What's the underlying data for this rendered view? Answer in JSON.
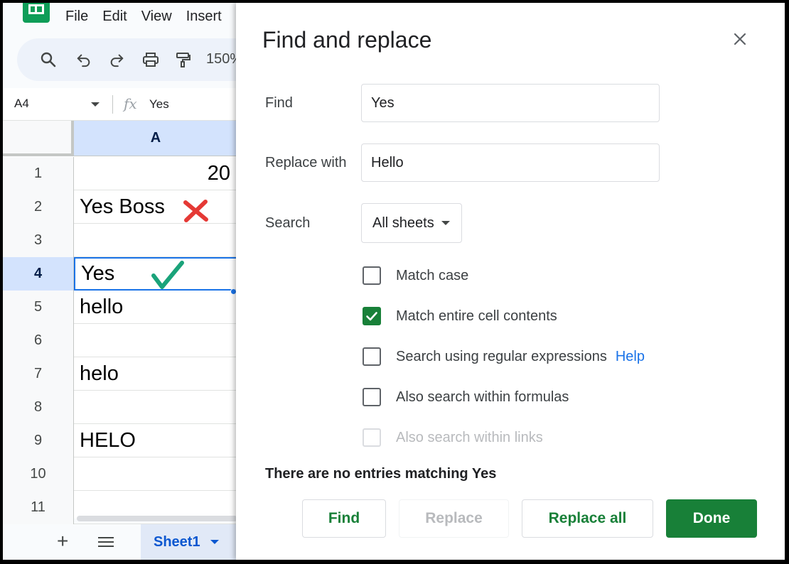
{
  "menu": [
    "File",
    "Edit",
    "View",
    "Insert"
  ],
  "toolbar": {
    "zoom": "150%"
  },
  "formula_bar": {
    "name_box": "A4",
    "fx": "fx",
    "value": "Yes"
  },
  "grid": {
    "column_header": "A",
    "rows": [
      {
        "num": "1",
        "value": "20"
      },
      {
        "num": "2",
        "value": "Yes Boss"
      },
      {
        "num": "3",
        "value": ""
      },
      {
        "num": "4",
        "value": "Yes"
      },
      {
        "num": "5",
        "value": "hello"
      },
      {
        "num": "6",
        "value": ""
      },
      {
        "num": "7",
        "value": "helo"
      },
      {
        "num": "8",
        "value": ""
      },
      {
        "num": "9",
        "value": "HELO"
      },
      {
        "num": "10",
        "value": ""
      },
      {
        "num": "11",
        "value": ""
      }
    ],
    "selected_row": "4"
  },
  "sheet_tabs": {
    "add": "+",
    "active": "Sheet1"
  },
  "dialog": {
    "title": "Find and replace",
    "find_label": "Find",
    "find_value": "Yes",
    "replace_label": "Replace with",
    "replace_value": "Hello",
    "search_label": "Search",
    "search_value": "All sheets",
    "options": {
      "match_case": {
        "label": "Match case",
        "checked": false
      },
      "match_entire": {
        "label": "Match entire cell contents",
        "checked": true
      },
      "regex": {
        "label": "Search using regular expressions",
        "checked": false,
        "help": "Help"
      },
      "formulas": {
        "label": "Also search within formulas",
        "checked": false
      },
      "links": {
        "label": "Also search within links",
        "checked": false,
        "disabled": true
      }
    },
    "status": "There are no entries matching Yes",
    "buttons": {
      "find": "Find",
      "replace": "Replace",
      "replace_all": "Replace all",
      "done": "Done"
    }
  },
  "colors": {
    "accent_green": "#188038",
    "link_blue": "#1a73e8",
    "selection_blue": "#d3e3fd"
  }
}
